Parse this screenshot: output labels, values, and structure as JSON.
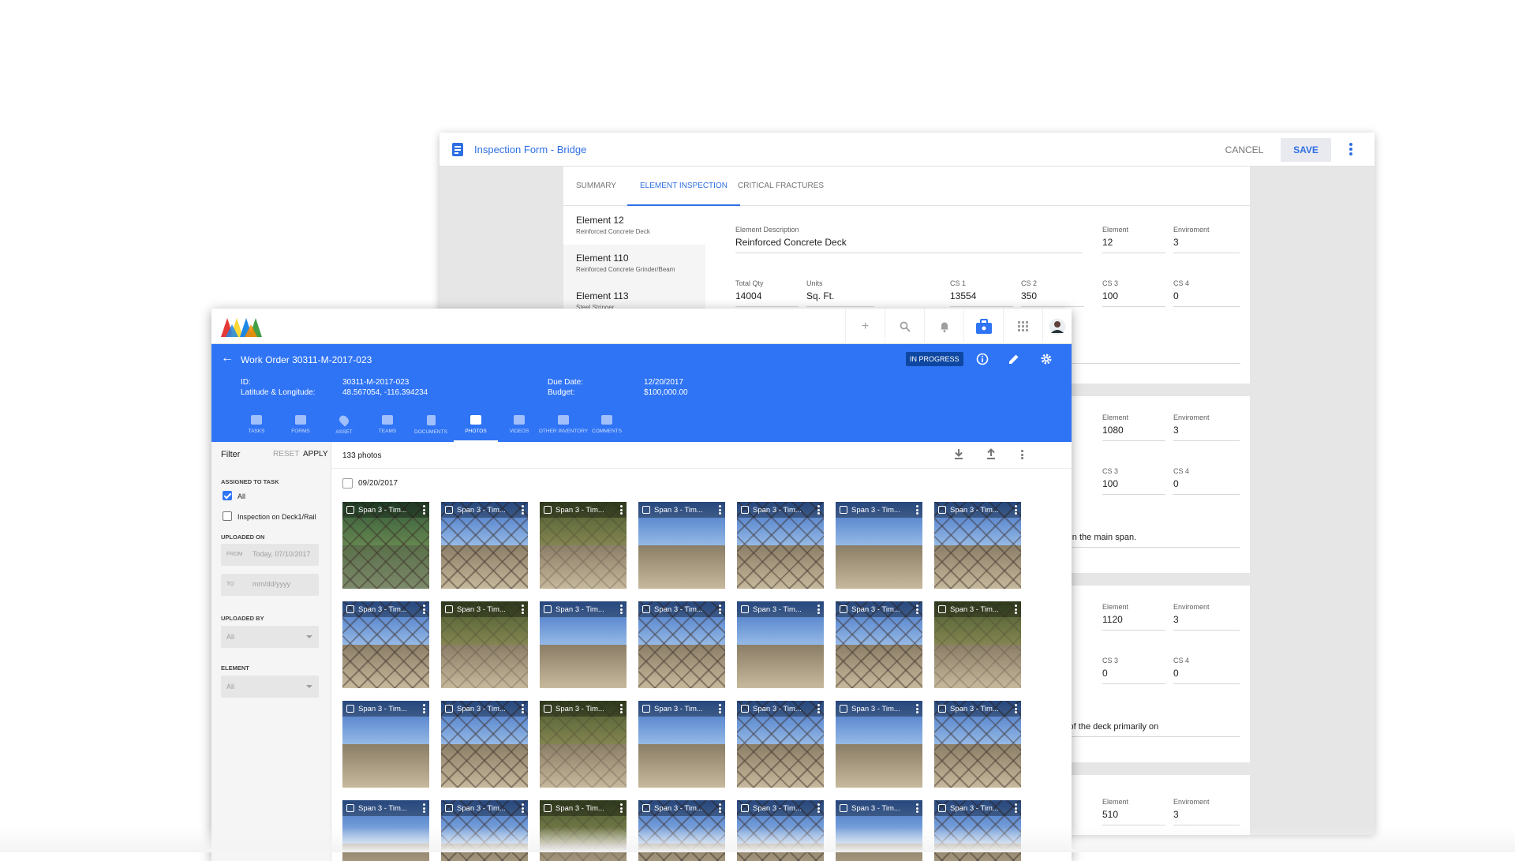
{
  "inspection": {
    "title": "Inspection Form - Bridge",
    "cancel_label": "CANCEL",
    "save_label": "SAVE",
    "tabs": [
      {
        "label": "SUMMARY"
      },
      {
        "label": "ELEMENT INSPECTION"
      },
      {
        "label": "CRITICAL FRACTURES"
      }
    ],
    "elements": [
      {
        "title": "Element 12",
        "subtitle": "Reinforced Concrete Deck"
      },
      {
        "title": "Element 110",
        "subtitle": "Reinforced Concrete Grinder/Beam"
      },
      {
        "title": "Element 113",
        "subtitle": "Steel Stringer"
      }
    ],
    "detail": {
      "desc_label": "Element Description",
      "desc_value": "Reinforced Concrete Deck",
      "element_label": "Element",
      "element_value": "12",
      "env_label": "Enviroment",
      "env_value": "3",
      "total_qty_label": "Total Qty",
      "total_qty_value": "14004",
      "units_label": "Units",
      "units_value": "Sq. Ft.",
      "cs1_label": "CS 1",
      "cs1_value": "13554",
      "cs2_label": "CS 2",
      "cs2_value": "350",
      "cs3_label": "CS 3",
      "cs3_value": "100",
      "cs4_label": "CS 4",
      "cs4_value": "0"
    },
    "panels": [
      {
        "element": "1080",
        "env": "3",
        "cs3": "100",
        "cs4": "0",
        "note": "ack of cover in the main span."
      },
      {
        "element": "1120",
        "env": "3",
        "cs3": "0",
        "cs4": "0",
        "note": "e underside of the deck primarily on"
      },
      {
        "element": "510",
        "env": "3"
      }
    ]
  },
  "workorder": {
    "title": "Work Order 30311-M-2017-023",
    "status": "IN PROGRESS",
    "id_label": "ID:",
    "id_value": "30311-M-2017-023",
    "latlon_label": "Latitude & Longitude:",
    "latlon_value": "48.567054, -116.394234",
    "due_label": "Due Date:",
    "due_value": "12/20/2017",
    "budget_label": "Budget:",
    "budget_value": "$100,000.00",
    "tabs": [
      {
        "label": "TASKS"
      },
      {
        "label": "FORMS"
      },
      {
        "label": "ASSET"
      },
      {
        "label": "TEAMS"
      },
      {
        "label": "DOCUMENTS"
      },
      {
        "label": "PHOTOS"
      },
      {
        "label": "VIDEOS"
      },
      {
        "label": "OTHER INVENTORY"
      },
      {
        "label": "COMMENTS"
      }
    ],
    "active_tab": "PHOTOS"
  },
  "filter": {
    "title": "Filter",
    "reset_label": "RESET",
    "apply_label": "APPLY",
    "assigned_label": "ASSIGNED TO TASK",
    "option_all": "All",
    "option_task": "Inspection on Deck1/Rail",
    "uploaded_on_label": "UPLOADED ON",
    "from_label": "FROM",
    "from_value": "Today, 07/10/2017",
    "to_label": "TO",
    "to_placeholder": "mm/dd/yyyy",
    "uploaded_by_label": "UPLOADED BY",
    "uploaded_by_value": "All",
    "element_label": "ELEMENT",
    "element_value": "All"
  },
  "photos": {
    "count": "133 photos",
    "date_group": "09/20/2017",
    "caption": "Span 3 - Tim...",
    "grid": [
      [
        "v1",
        "v0",
        "v3",
        "v2",
        "v0",
        "v2",
        "v0"
      ],
      [
        "v0",
        "v3",
        "v2",
        "v0",
        "v2",
        "v0",
        "v3"
      ],
      [
        "v2",
        "v0",
        "v3",
        "v2",
        "v0",
        "v2",
        "v0"
      ],
      [
        "v2",
        "v0",
        "v3",
        "v0",
        "v0",
        "v2",
        "v0"
      ]
    ]
  },
  "colors": {
    "brand_blue": "#2f74f5",
    "status_dark": "#0d47a1"
  }
}
